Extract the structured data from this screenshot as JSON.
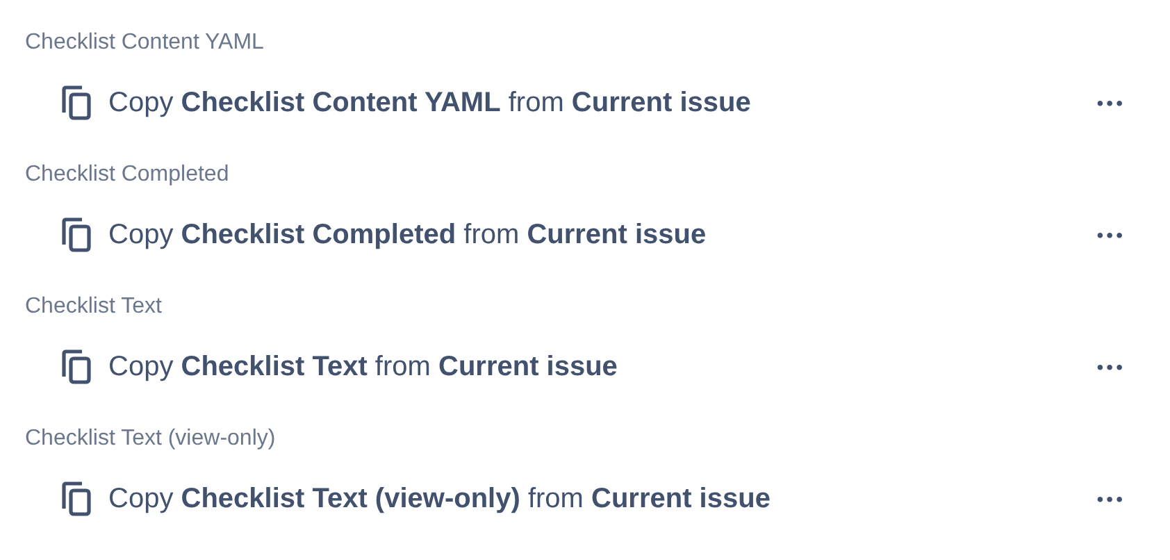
{
  "sections": [
    {
      "label": "Checklist Content YAML",
      "action": "Copy **Checklist Content YAML** from **Current issue**",
      "menu": "•••"
    },
    {
      "label": "Checklist Completed",
      "action": "Copy **Checklist Completed** from **Current issue**",
      "menu": "•••"
    },
    {
      "label": "Checklist Text",
      "action": "Copy **Checklist Text** from **Current issue**",
      "menu": "•••"
    },
    {
      "label": "Checklist Text (view-only)",
      "action": "Copy **Checklist Text (view-only)** from **Current issue**",
      "menu": "•••"
    }
  ]
}
